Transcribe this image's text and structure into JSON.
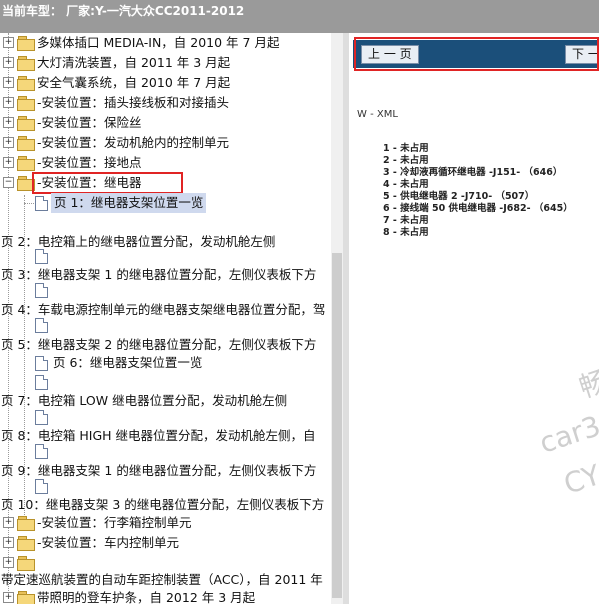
{
  "header": {
    "car_type": "当前车型：  厂家:Y-一汽大众CC2011-2012"
  },
  "tree": {
    "items": [
      {
        "label": "多媒体插口 MEDIA-IN，自 2010 年 7 月起"
      },
      {
        "label": "大灯清洗装置，自 2011 年 3 月起"
      },
      {
        "label": "安全气囊系统，自 2010 年 7 月起"
      },
      {
        "label": "-安装位置：插头接线板和对接插头"
      },
      {
        "label": "-安装位置：保险丝"
      },
      {
        "label": "-安装位置：发动机舱内的控制单元"
      },
      {
        "label": "-安装位置：接地点"
      },
      {
        "label": "-安装位置：继电器"
      },
      {
        "label": "页 1：继电器支架位置一览"
      },
      {
        "label": "页 2：电控箱上的继电器位置分配，发动机舱左侧"
      },
      {
        "label": "页 3：继电器支架 1 的继电器位置分配，左侧仪表板下方"
      },
      {
        "label": "页 4：车载电源控制单元的继电器支架继电器位置分配，驾"
      },
      {
        "label": "页 5：继电器支架 2 的继电器位置分配，左侧仪表板下方"
      },
      {
        "label": "页 6：继电器支架位置一览"
      },
      {
        "label": "页 7：电控箱 LOW 继电器位置分配，发动机舱左侧"
      },
      {
        "label": "页 8：电控箱 HIGH 继电器位置分配，发动机舱左侧，自"
      },
      {
        "label": "页 9：继电器支架 1 的继电器位置分配，左侧仪表板下方"
      },
      {
        "label": "页 10：继电器支架 3 的继电器位置分配，左侧仪表板下方"
      },
      {
        "label": "-安装位置：行李箱控制单元"
      },
      {
        "label": "-安装位置：车内控制单元"
      },
      {
        "label": "带定速巡航装置的自动车距控制装置（ACC），自 2011 年"
      },
      {
        "label": "带照明的登车护条，自 2012 年 3 月起"
      }
    ],
    "expanders": {
      "plus": "+",
      "minus": "−"
    }
  },
  "viewer": {
    "prev_button": "上 一 页",
    "next_button": "下 一",
    "doc_title": "W - XML",
    "legend": [
      "1 - 未占用",
      "2 - 未占用",
      "3 - 冷却液再循环继电器 -J151- （646）",
      "4 - 未占用",
      "5 - 供电继电器 2 -J710- （507）",
      "6 - 接线端 50 供电继电器 -J682- （645）",
      "7 - 未占用",
      "8 - 未占用"
    ],
    "watermark": [
      "畅",
      "car3",
      "CY"
    ]
  },
  "colors": {
    "highlight_box": "#e02424",
    "nav_bar": "#1b4f7a",
    "topbar": "#9a9a9a"
  }
}
